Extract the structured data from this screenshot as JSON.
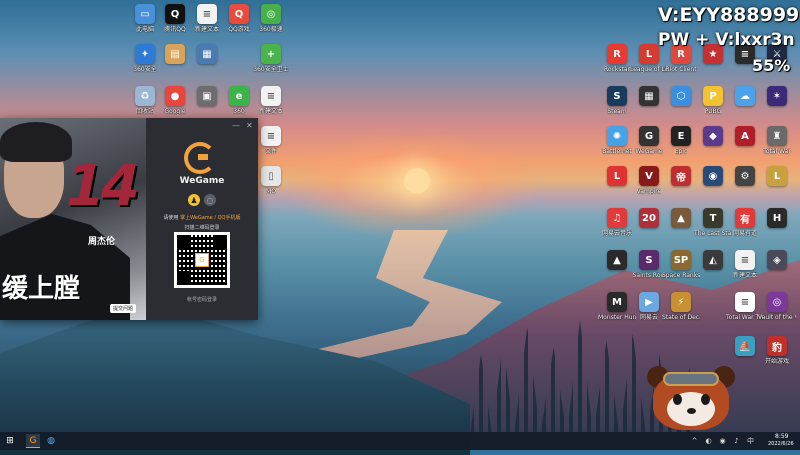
{
  "overlay": {
    "contact": "V:EYY888999",
    "pw": "PW + V:lxxr3n",
    "percent": "55%"
  },
  "desktop_left": [
    {
      "label": "此电脑",
      "color": "#4a90d9",
      "glyph": "▭",
      "icon": "computer-icon"
    },
    {
      "label": "腾讯QQ",
      "color": "#111",
      "glyph": "Q",
      "icon": "qq-icon"
    },
    {
      "label": "新建文本",
      "color": "#f2f2f2",
      "glyph": "≡",
      "icon": "text-file-icon"
    },
    {
      "label": "QQ游戏",
      "color": "#e84c3d",
      "glyph": "Q",
      "icon": "qq-game-icon"
    },
    {
      "label": "360极速",
      "color": "#47b04b",
      "glyph": "◎",
      "icon": "browser-360-icon"
    },
    {
      "label": "360安全",
      "color": "#2e7bd6",
      "glyph": "✦",
      "icon": "shield-icon"
    },
    {
      "label": "",
      "color": "#d9a45a",
      "glyph": "▤",
      "icon": "folder-icon"
    },
    {
      "label": "",
      "color": "#4b7ab0",
      "glyph": "▦",
      "icon": "app-icon"
    },
    {
      "label": "360安全卫士",
      "color": "#4bb34b",
      "glyph": "+",
      "icon": "guard-icon"
    },
    {
      "label": "回收站",
      "color": "#9bb7d4",
      "glyph": "♻",
      "icon": "recycle-icon"
    },
    {
      "label": "Google",
      "color": "#e8453c",
      "glyph": "●",
      "icon": "chrome-icon"
    },
    {
      "label": "",
      "color": "#6d6d6d",
      "glyph": "▣",
      "icon": "app-icon"
    },
    {
      "label": "360",
      "color": "#3bb54a",
      "glyph": "e",
      "icon": "ie-icon"
    },
    {
      "label": "新建文本",
      "color": "#f2f2f2",
      "glyph": "≡",
      "icon": "text-file-icon"
    },
    {
      "label": "文件",
      "color": "#f2f2f2",
      "glyph": "≡",
      "icon": "text-file-icon"
    },
    {
      "label": "MO",
      "color": "#e6e6e6",
      "glyph": "▯",
      "icon": "phone-icon"
    }
  ],
  "desktop_right": [
    {
      "label": "Rockstar",
      "color": "#e83a30",
      "glyph": "R"
    },
    {
      "label": "League of Legends",
      "color": "#d63b2f",
      "glyph": "L"
    },
    {
      "label": "Riot Client",
      "color": "#e0483d",
      "glyph": "R"
    },
    {
      "label": "",
      "color": "#c53030",
      "glyph": "★"
    },
    {
      "label": "",
      "color": "#2b2b2b",
      "glyph": "≡"
    },
    {
      "label": "",
      "color": "#1f2a44",
      "glyph": "⚔"
    },
    {
      "label": "Steam",
      "color": "#1b3b5c",
      "glyph": "S"
    },
    {
      "label": "",
      "color": "#333",
      "glyph": "▦"
    },
    {
      "label": "",
      "color": "#3a8fe0",
      "glyph": "⬡"
    },
    {
      "label": "PUBG",
      "color": "#f2c230",
      "glyph": "P"
    },
    {
      "label": "",
      "color": "#4aa3e8",
      "glyph": "☁"
    },
    {
      "label": "",
      "color": "#3a2a7a",
      "glyph": "✶"
    },
    {
      "label": "Battle.net",
      "color": "#46a2e6",
      "glyph": "✺"
    },
    {
      "label": "WeGame",
      "color": "#333",
      "glyph": "G"
    },
    {
      "label": "Epic",
      "color": "#222",
      "glyph": "E"
    },
    {
      "label": "",
      "color": "#5a3a8a",
      "glyph": "◆"
    },
    {
      "label": "",
      "color": "#b01e2a",
      "glyph": "A"
    },
    {
      "label": "Total War",
      "color": "#6a6a6a",
      "glyph": "♜"
    },
    {
      "label": "",
      "color": "#d33",
      "glyph": "L"
    },
    {
      "label": "Vampire",
      "color": "#8a1a1a",
      "glyph": "V"
    },
    {
      "label": "",
      "color": "#c02f2f",
      "glyph": "帝"
    },
    {
      "label": "",
      "color": "#2a4a7a",
      "glyph": "◉"
    },
    {
      "label": "",
      "color": "#444",
      "glyph": "⚙"
    },
    {
      "label": "",
      "color": "#c8a040",
      "glyph": "L"
    },
    {
      "label": "网易云音乐",
      "color": "#e03a3a",
      "glyph": "♫"
    },
    {
      "label": "",
      "color": "#b0303a",
      "glyph": "20"
    },
    {
      "label": "",
      "color": "#7a5a3a",
      "glyph": "▲"
    },
    {
      "label": "The Last Stand",
      "color": "#3a3a2a",
      "glyph": "T"
    },
    {
      "label": "网易有道",
      "color": "#e03a3a",
      "glyph": "有"
    },
    {
      "label": "",
      "color": "#2a2a2a",
      "glyph": "H"
    },
    {
      "label": "",
      "color": "#2a2a2a",
      "glyph": "▲"
    },
    {
      "label": "Saints Row",
      "color": "#5a2a6a",
      "glyph": "S"
    },
    {
      "label": "Space Ranks",
      "color": "#8a6a30",
      "glyph": "SP"
    },
    {
      "label": "",
      "color": "#3a3a3a",
      "glyph": "◭"
    },
    {
      "label": "新建文本",
      "color": "#f2f2f2",
      "glyph": "≡"
    },
    {
      "label": "",
      "color": "#4a4a5a",
      "glyph": "◈"
    },
    {
      "label": "Monster Hunter",
      "color": "#2a2a2a",
      "glyph": "M"
    },
    {
      "label": "网易云",
      "color": "#6aa8e0",
      "glyph": "▶"
    },
    {
      "label": "State of Decay 2",
      "color": "#c89030",
      "glyph": "⚡"
    },
    {
      "label": "",
      "color": "",
      "glyph": ""
    },
    {
      "label": "Total War THREE",
      "color": "#ffffff",
      "glyph": "≡"
    },
    {
      "label": "Vault of the Void",
      "color": "#7a3a9a",
      "glyph": "◎"
    },
    {
      "label": "",
      "color": "",
      "glyph": ""
    },
    {
      "label": "",
      "color": "",
      "glyph": ""
    },
    {
      "label": "",
      "color": "",
      "glyph": ""
    },
    {
      "label": "",
      "color": "",
      "glyph": ""
    },
    {
      "label": "",
      "color": "#3aa0c0",
      "glyph": "⛵"
    },
    {
      "label": "开始游戏",
      "color": "#c0302a",
      "glyph": "豹"
    }
  ],
  "launcher": {
    "brand": "WeGame",
    "number": "14",
    "calligraphy": "缓上膛",
    "artist": "周杰伦",
    "artist_tag": "",
    "bubble": "提交问题",
    "hint_prefix": "请使用",
    "hint_highlight": "掌上WeGame / QQ手机版",
    "scan": "扫描二维码登录",
    "account": "帐号密码登录",
    "win_min": "—",
    "win_close": "✕"
  },
  "taskbar": {
    "start": "⊞",
    "time": "8:59",
    "date": "2022/6/26",
    "tray": [
      "^",
      "◐",
      "◉",
      "♪",
      "中"
    ]
  }
}
